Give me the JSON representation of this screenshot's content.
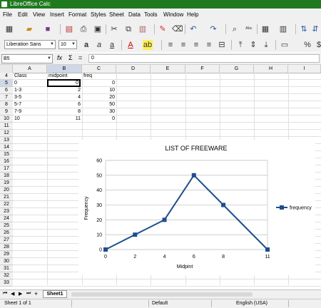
{
  "window": {
    "title": "LibreOffice Calc"
  },
  "menu": [
    "File",
    "Edit",
    "View",
    "Insert",
    "Format",
    "Styles",
    "Sheet",
    "Data",
    "Tools",
    "Window",
    "Help"
  ],
  "toolbar": {
    "font_name": "Liberation Sans",
    "font_size": "10",
    "icons": [
      "new-icon",
      "open-icon",
      "save-icon",
      "export-pdf-icon",
      "print-icon",
      "print-preview-icon",
      "cut-icon",
      "copy-icon",
      "paste-icon",
      "clone-icon",
      "clear-icon",
      "undo-icon",
      "redo-icon",
      "find-icon",
      "spelling-icon",
      "row-icon",
      "column-icon",
      "sort-asc-icon",
      "sort-desc-icon"
    ]
  },
  "formula_bar": {
    "name_box": "B5",
    "fx": "fx",
    "sum": "Σ",
    "eq": "=",
    "content": "0"
  },
  "columns": [
    "A",
    "B",
    "C",
    "D",
    "E",
    "F",
    "G",
    "H",
    "I"
  ],
  "rows": [
    "4",
    "5",
    "6",
    "7",
    "8",
    "9",
    "10",
    "11",
    "12",
    "13",
    "14",
    "15",
    "16",
    "17",
    "18",
    "19",
    "20",
    "21",
    "22",
    "23",
    "24",
    "25",
    "26",
    "27",
    "28",
    "29",
    "30",
    "31",
    "32",
    "33"
  ],
  "table": {
    "headers": [
      "Class",
      "midpoint",
      "freq"
    ],
    "data": [
      [
        "0",
        "0",
        "0"
      ],
      [
        "1-3",
        "2",
        "10"
      ],
      [
        "3-5",
        "4",
        "20"
      ],
      [
        "5-7",
        "6",
        "50"
      ],
      [
        "7-9",
        "8",
        "30"
      ],
      [
        "10",
        "11",
        "0"
      ]
    ]
  },
  "chart_data": {
    "type": "line",
    "title": "LIST OF FREEWARE",
    "xlabel": "Midpint",
    "ylabel": "Frequency",
    "categories": [
      "0",
      "2",
      "4",
      "6",
      "8",
      "11"
    ],
    "series": [
      {
        "name": "frequency",
        "values": [
          0,
          10,
          20,
          50,
          30,
          0
        ]
      }
    ],
    "ylim": [
      0,
      60
    ],
    "yticks": [
      "0",
      "10",
      "20",
      "30",
      "40",
      "50",
      "60"
    ],
    "grid": true,
    "legend": "right",
    "color": "#1f4e8c"
  },
  "sheet_tabs": [
    "Sheet1"
  ],
  "status": {
    "sheet": "Sheet 1 of 1",
    "style": "Default",
    "language": "English (USA)"
  }
}
